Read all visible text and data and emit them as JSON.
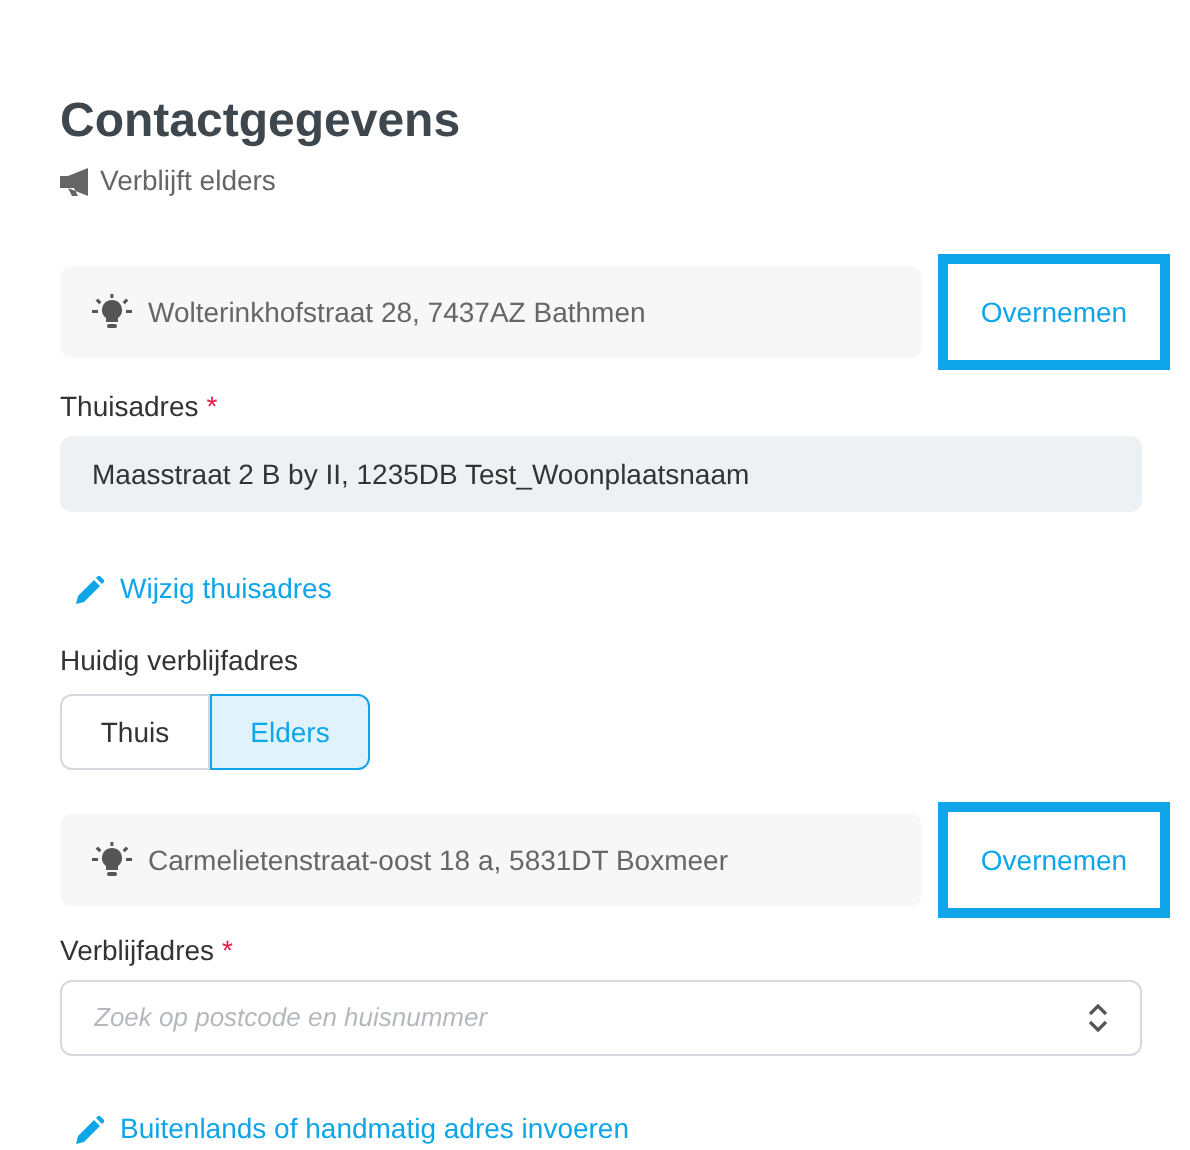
{
  "title": "Contactgegevens",
  "status": "Verblijft elders",
  "home_suggestion": {
    "address": "Wolterinkhofstraat 28, 7437AZ Bathmen",
    "button": "Overnemen"
  },
  "home_address": {
    "label": "Thuisadres",
    "required": "*",
    "value": "Maasstraat 2 B by II, 1235DB Test_Woonplaatsnaam"
  },
  "edit_home_link": "Wijzig thuisadres",
  "current_stay": {
    "label": "Huidig verblijfadres",
    "options": [
      {
        "label": "Thuis",
        "selected": false
      },
      {
        "label": "Elders",
        "selected": true
      }
    ]
  },
  "stay_suggestion": {
    "address": "Carmelietenstraat-oost 18 a, 5831DT Boxmeer",
    "button": "Overnemen"
  },
  "stay_address": {
    "label": "Verblijfadres",
    "required": "*",
    "placeholder": "Zoek op postcode en huisnummer"
  },
  "manual_link": "Buitenlands of handmatig adres invoeren"
}
